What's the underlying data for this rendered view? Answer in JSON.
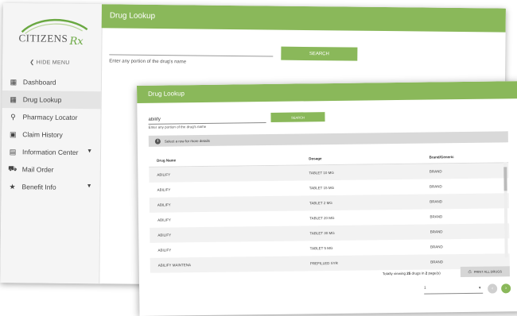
{
  "back": {
    "logo_text": "CITIZENS",
    "logo_rx": "Rx",
    "hide_menu": "HIDE MENU",
    "nav": [
      {
        "label": "Dashboard",
        "icon": "dashboard-icon"
      },
      {
        "label": "Drug Lookup",
        "icon": "pill-icon"
      },
      {
        "label": "Pharmacy Locator",
        "icon": "location-pin-icon"
      },
      {
        "label": "Claim History",
        "icon": "claim-icon"
      },
      {
        "label": "Information Center",
        "icon": "info-grid-icon"
      },
      {
        "label": "Mail Order",
        "icon": "truck-icon"
      },
      {
        "label": "Benefit Info",
        "icon": "star-icon"
      }
    ],
    "title": "Drug Lookup",
    "search_label": "SEARCH",
    "hint": "Enter any portion of the drug's name"
  },
  "front": {
    "title": "Drug Lookup",
    "search_value": "abilify",
    "search_label": "SEARCH",
    "hint": "Enter any portion of the drug's name",
    "info_text": "Select a row for more details",
    "table": {
      "headers": [
        "Drug Name",
        "Dosage",
        "Brand/Generic"
      ],
      "rows": [
        [
          "ABILIFY",
          "TABLET 10 MG",
          "BRAND"
        ],
        [
          "ABILIFY",
          "TABLET 15 MG",
          "BRAND"
        ],
        [
          "ABILIFY",
          "TABLET 2 MG",
          "BRAND"
        ],
        [
          "ABILIFY",
          "TABLET 20 MG",
          "BRAND"
        ],
        [
          "ABILIFY",
          "TABLET 30 MG",
          "BRAND"
        ],
        [
          "ABILIFY",
          "TABLET 5 MG",
          "BRAND"
        ],
        [
          "ABILIFY MAINTENA",
          "PREFILLED SYR",
          "BRAND"
        ]
      ]
    },
    "total_prefix": "Totally viewing ",
    "total_count": "25",
    "total_mid": " drugs in ",
    "total_pages": "2",
    "total_suffix": " page(s)",
    "print_label": "PRINT ALL DRUGS",
    "page_value": "1"
  },
  "colors": {
    "accent": "#8ab85a"
  }
}
